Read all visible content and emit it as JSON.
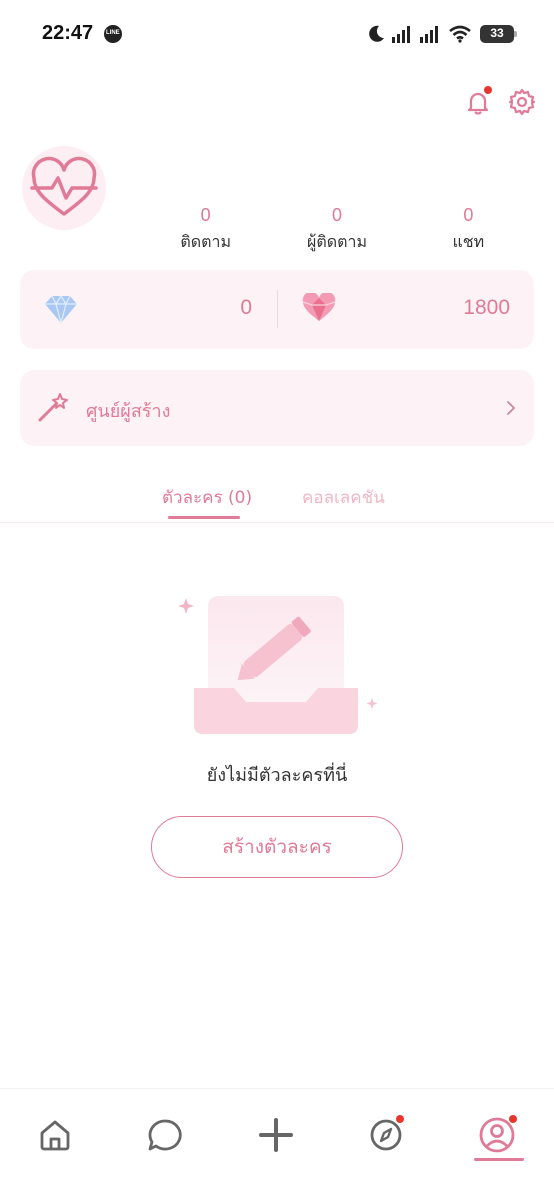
{
  "status_bar": {
    "time": "22:47",
    "notification_icon": "line-icon",
    "line_label": "LINE",
    "battery": "33"
  },
  "header": {
    "notifications_has_badge": true,
    "settings_icon": "gear-icon"
  },
  "profile": {
    "avatar_icon": "heartbeat-heart-icon",
    "stats": [
      {
        "value": "0",
        "label": "ติดตาม"
      },
      {
        "value": "0",
        "label": "ผู้ติดตาม"
      },
      {
        "value": "0",
        "label": "แชท"
      }
    ]
  },
  "wallet": {
    "diamond_value": "0",
    "heart_value": "1800"
  },
  "creator_center": {
    "label": "ศูนย์ผู้สร้าง"
  },
  "tabs": [
    {
      "label": "ตัวละคร (0)",
      "active": true
    },
    {
      "label": "คอลเลคชัน",
      "active": false
    }
  ],
  "empty_state": {
    "message": "ยังไม่มีตัวละครที่นี่",
    "button_label": "สร้างตัวละคร"
  },
  "bottom_nav": [
    {
      "name": "home",
      "icon": "home-icon",
      "badge": false,
      "active": false
    },
    {
      "name": "chat",
      "icon": "chat-bubble-icon",
      "badge": false,
      "active": false
    },
    {
      "name": "create",
      "icon": "plus-icon",
      "badge": false,
      "active": false
    },
    {
      "name": "explore",
      "icon": "compass-icon",
      "badge": true,
      "active": false
    },
    {
      "name": "profile",
      "icon": "profile-icon",
      "badge": true,
      "active": true
    }
  ],
  "colors": {
    "accent": "#e07a97",
    "accent_light": "#fdf3f6",
    "badge_red": "#e8352e"
  }
}
